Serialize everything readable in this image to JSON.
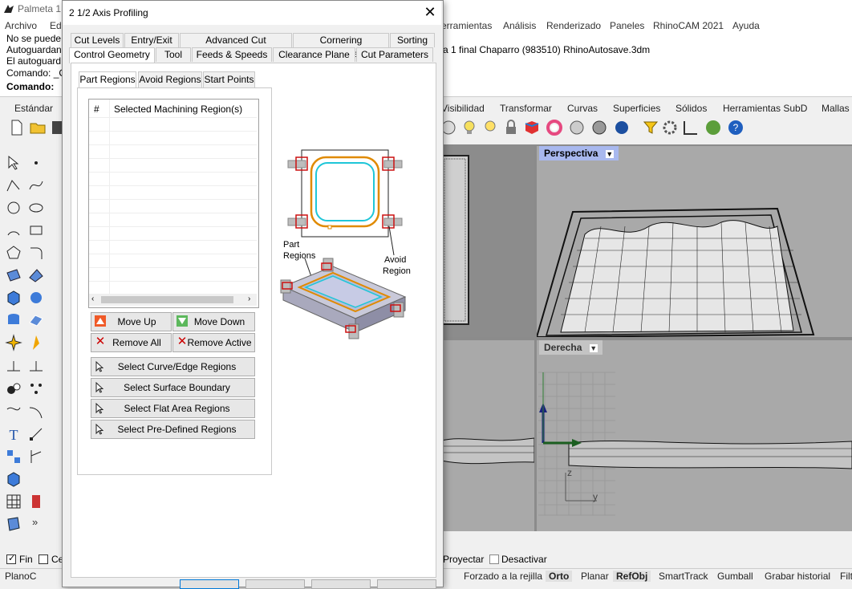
{
  "rhino": {
    "title": "Palmeta 1",
    "menus": [
      "Archivo",
      "Ed",
      "erramientas",
      "Análisis",
      "Renderizado",
      "Paneles",
      "RhinoCAM 2021",
      "Ayuda"
    ],
    "command_lines": [
      "No se puede",
      "Autoguardan",
      "El autoguard",
      "Comando: _C"
    ],
    "command_prompt": "Comando:",
    "file_info": "a 1 final Chaparro (983510) RhinoAutosave.3dm",
    "toolbar_tabs": [
      "Estándar",
      "Visibilidad",
      "Transformar",
      "Curvas",
      "Superficies",
      "Sólidos",
      "Herramientas SubD",
      "Mallas"
    ],
    "viewport_perspective": "Perspectiva",
    "viewport_right": "Derecha",
    "osnap": {
      "fin": "Fin",
      "ce": "Ce",
      "proyectar": "Proyectar",
      "desactivar": "Desactivar"
    },
    "status_items": [
      "PlanoC",
      "Forzado a la rejilla",
      "Orto",
      "Planar",
      "RefObj",
      "SmartTrack",
      "Gumball",
      "Grabar historial",
      "Filt"
    ],
    "axis_labels": {
      "z": "z",
      "y": "y"
    }
  },
  "dialog": {
    "title": "2 1/2 Axis Profiling",
    "close": "✕",
    "tabs_row1": [
      "Cut Levels",
      "Entry/Exit",
      "Advanced Cut Parameters",
      "Cornering Parameters",
      "Sorting"
    ],
    "tabs_row2": [
      "Control Geometry",
      "Tool",
      "Feeds & Speeds",
      "Clearance Plane",
      "Cut Parameters"
    ],
    "active_tab": "Control Geometry",
    "subtabs": [
      "Part Regions",
      "Avoid Regions",
      "Start Points"
    ],
    "active_subtab": "Part Regions",
    "list": {
      "col_index": "#",
      "col_name": "Selected Machining Region(s)",
      "rows": []
    },
    "buttons": {
      "move_up": "Move Up",
      "move_down": "Move Down",
      "remove_all": "Remove All",
      "remove_active": "Remove Active",
      "select_curve": "Select Curve/Edge Regions",
      "select_surface": "Select Surface Boundary",
      "select_flat": "Select Flat Area Regions",
      "select_predefined": "Select Pre-Defined Regions"
    },
    "illustration": {
      "part_regions_label": [
        "Part",
        "Regions"
      ],
      "avoid_region_label": [
        "Avoid",
        "Region"
      ]
    }
  },
  "colors": {
    "accent_orange": "#e08a00",
    "accent_cyan": "#1fc6d8",
    "avoid_red": "#cc1111",
    "move_up_red": "#e64a19",
    "move_down_green": "#4caf50"
  }
}
